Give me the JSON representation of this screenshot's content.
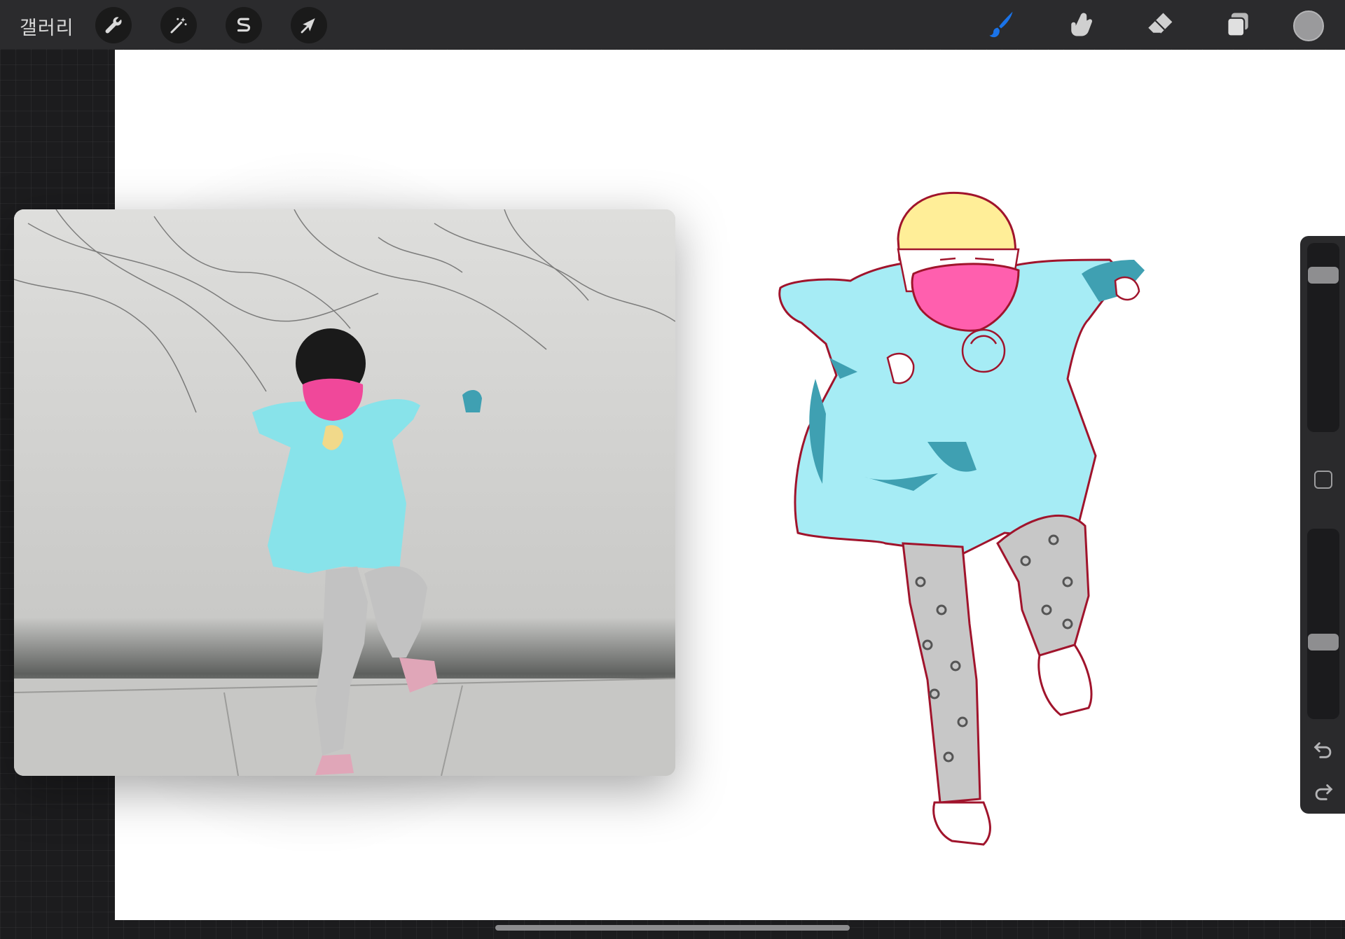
{
  "topbar": {
    "gallery_label": "갤러리",
    "left_tools": [
      {
        "name": "actions",
        "icon": "wrench-icon"
      },
      {
        "name": "adjustments",
        "icon": "magic-wand-icon"
      },
      {
        "name": "selection",
        "icon": "selection-s-icon"
      },
      {
        "name": "transform",
        "icon": "arrow-cursor-icon"
      }
    ],
    "right_tools": [
      {
        "name": "brush",
        "icon": "brush-icon",
        "active": true,
        "color": "#1a73e8"
      },
      {
        "name": "smudge",
        "icon": "smudge-finger-icon"
      },
      {
        "name": "eraser",
        "icon": "eraser-icon"
      },
      {
        "name": "layers",
        "icon": "layers-icon"
      }
    ],
    "current_color": "#9a9a9c"
  },
  "sidebar": {
    "brush_size_level": 0.1,
    "opacity_level": 0.62,
    "icons": [
      "modifier-square-icon",
      "undo-icon",
      "redo-icon"
    ]
  },
  "colors": {
    "outline": "#a0142c",
    "dress": "#a6ecf5",
    "dress_shadow": "#3fa0b2",
    "mask": "#ff5fae",
    "hair": "#ffee98",
    "leggings": "#c7c7c7"
  }
}
